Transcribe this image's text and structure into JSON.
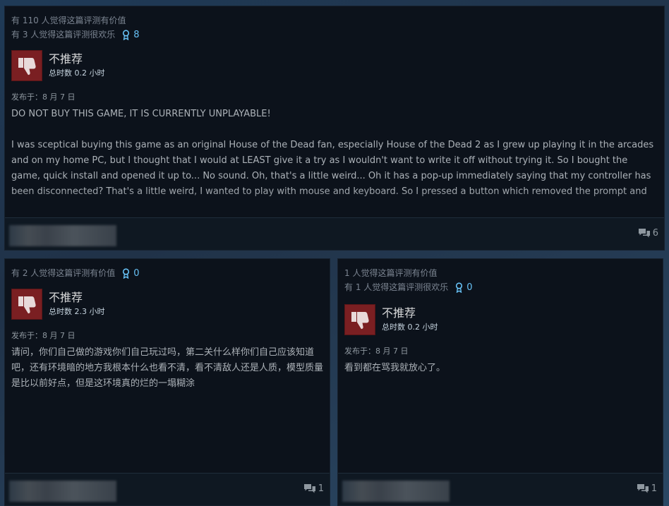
{
  "reviews": [
    {
      "helpful_count": "有 110 人觉得这篇评测有价值",
      "funny_count": "有 3 人觉得这篇评测很欢乐",
      "award_count": "8",
      "verdict": "不推荐",
      "hours": "总时数 0.2 小时",
      "posted": "发布于：8 月 7 日",
      "text_lines": [
        "DO NOT BUY THIS GAME, IT IS CURRENTLY UNPLAYABLE!",
        "",
        "I was sceptical buying this game as an original House of the Dead fan, especially House of the Dead 2 as I grew up playing it in the arcades and on my home PC, but I thought that I would at LEAST give it a try as I wouldn't want to write it off without trying it. So I bought the game, quick install and opened it up to... No sound. Oh, that's a little weird... Oh it has a pop-up immediately saying that my controller has been disconnected? That's a little weird, I wanted to play with mouse and keyboard. So I pressed a button which removed the prompt and"
      ],
      "comment_count": "6"
    },
    {
      "helpful_count": "有 2 人觉得这篇评测有价值",
      "award_count": "0",
      "verdict": "不推荐",
      "hours": "总时数 2.3 小时",
      "posted": "发布于：8 月 7 日",
      "text": "请问，你们自己做的游戏你们自己玩过吗，第二关什么样你们自己应该知道吧，还有环境暗的地方我根本什么也看不清，看不清敌人还是人质，模型质量是比以前好点，但是这环境真的烂的一塌糊涂",
      "comment_count": "1"
    },
    {
      "helpful_count": "1 人觉得这篇评测有价值",
      "funny_count": "有 1 人觉得这篇评测很欢乐",
      "award_count": "0",
      "verdict": "不推荐",
      "hours": "总时数 0.2 小时",
      "posted": "发布于：8 月 7 日",
      "text": "看到都在骂我就放心了。",
      "comment_count": "1"
    }
  ],
  "colors": {
    "card_bg": "#0c121b",
    "thumb_down_bg": "#7a1f22",
    "award_blue": "#67c1f5",
    "text_muted": "#8f98a0"
  },
  "icons": {
    "thumb": "thumbs-down-icon",
    "award": "award-ribbon-icon",
    "comments": "comment-bubble-icon"
  }
}
